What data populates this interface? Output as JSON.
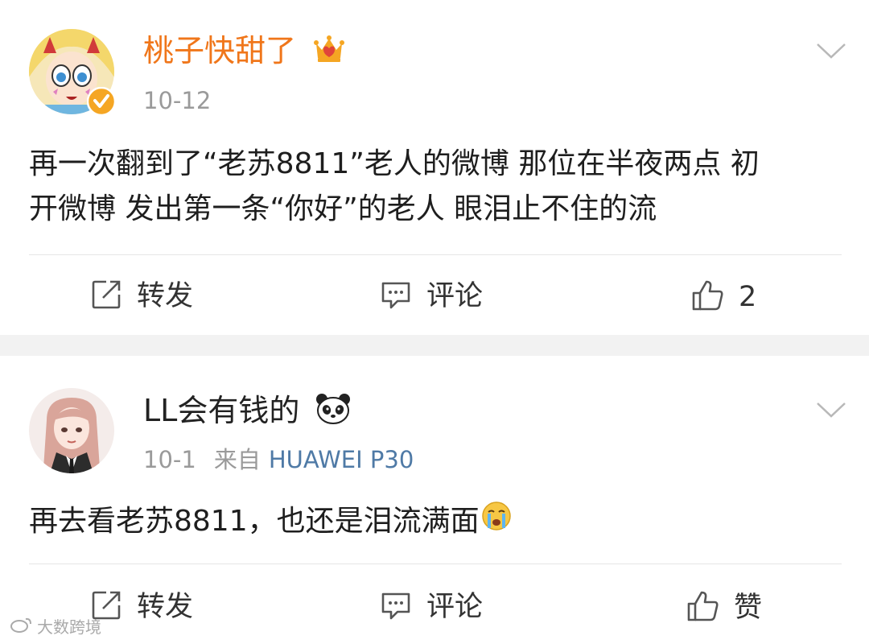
{
  "posts": [
    {
      "username": "桃子快甜了",
      "date": "10-12",
      "text_line1": "再一次翻到了“老苏8811”老人的微博 那位在半夜两点 初",
      "text_line2": "开微博 发出第一条“你好”的老人 眼泪止不住的流",
      "actions": {
        "repost": "转发",
        "comment": "评论",
        "like": "2"
      },
      "badge_icon": "crown-badge-icon",
      "verified_icon": "verified-badge-icon"
    },
    {
      "username": "LL会有钱的",
      "date": "10-1",
      "source_prefix": "来自",
      "device": "HUAWEI P30",
      "text": "再去看老苏8811，也还是泪流满面",
      "actions": {
        "repost": "转发",
        "comment": "评论",
        "like": "赞"
      },
      "name_emoji": "panda-emoji-icon",
      "text_emoji": "crying-emoji-icon"
    }
  ],
  "watermark": "大数跨境",
  "colors": {
    "username_orange": "#f0761a",
    "device_blue": "#4f7aa6",
    "meta_gray": "#9a9a9a",
    "separator": "#f2f2f2"
  }
}
